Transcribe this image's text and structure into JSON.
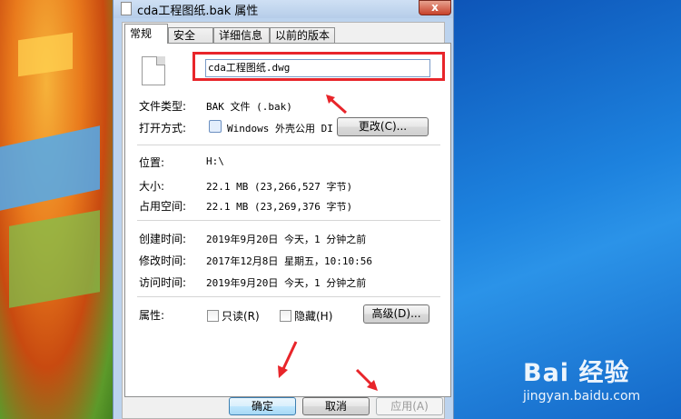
{
  "window": {
    "title": "cda工程图纸.bak 属性",
    "close_label": "x"
  },
  "tabs": [
    {
      "label": "常规",
      "active": true
    },
    {
      "label": "安全",
      "active": false
    },
    {
      "label": "详细信息",
      "active": false
    },
    {
      "label": "以前的版本",
      "active": false
    }
  ],
  "general": {
    "filename_value": "cda工程图纸.dwg",
    "file_type_label": "文件类型:",
    "file_type_value": "BAK 文件 (.bak)",
    "open_with_label": "打开方式:",
    "open_with_value": "Windows 外壳公用 DI",
    "change_button": "更改(C)...",
    "location_label": "位置:",
    "location_value": "H:\\",
    "size_label": "大小:",
    "size_value": "22.1 MB (23,266,527 字节)",
    "size_on_disk_label": "占用空间:",
    "size_on_disk_value": "22.1 MB (23,269,376 字节)",
    "created_label": "创建时间:",
    "created_value": "2019年9月20日 今天，1 分钟之前",
    "modified_label": "修改时间:",
    "modified_value": "2017年12月8日 星期五，10:10:56",
    "accessed_label": "访问时间:",
    "accessed_value": "2019年9月20日 今天，1 分钟之前",
    "attributes_label": "属性:",
    "readonly_label": "只读(R)",
    "readonly_checked": false,
    "hidden_label": "隐藏(H)",
    "hidden_checked": false,
    "advanced_button": "高级(D)..."
  },
  "footer": {
    "ok_button": "确定",
    "cancel_button": "取消",
    "apply_button": "应用(A)"
  },
  "watermark": {
    "logo_text": "Bai 经验",
    "url": "jingyan.baidu.com"
  },
  "colors": {
    "annotation_red": "#e8252a",
    "dialog_frame": "#bcd3ee"
  }
}
